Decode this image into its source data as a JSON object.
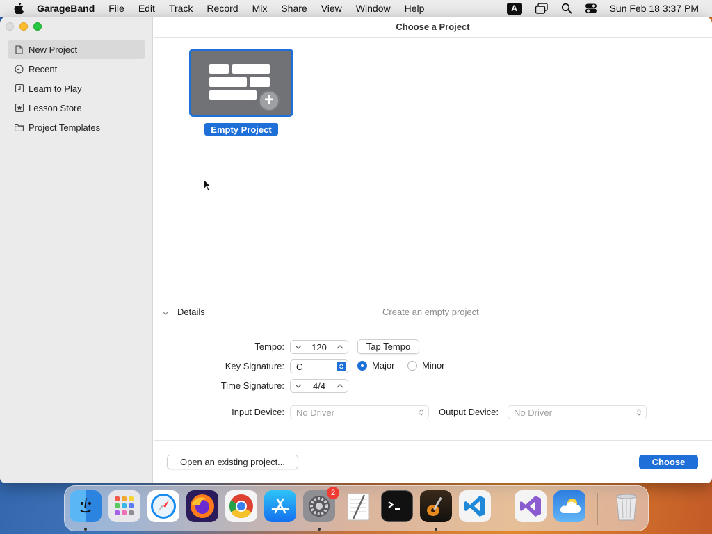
{
  "menubar": {
    "app_name": "GarageBand",
    "menus": [
      "File",
      "Edit",
      "Track",
      "Record",
      "Mix",
      "Share",
      "View",
      "Window",
      "Help"
    ],
    "input_source": "A",
    "clock": "Sun Feb 18  3:37 PM"
  },
  "window": {
    "title": "Choose a Project"
  },
  "sidebar": {
    "items": [
      {
        "label": "New Project",
        "icon": "document-icon",
        "selected": true
      },
      {
        "label": "Recent",
        "icon": "clock-icon",
        "selected": false
      },
      {
        "label": "Learn to Play",
        "icon": "music-note-icon",
        "selected": false
      },
      {
        "label": "Lesson Store",
        "icon": "star-icon",
        "selected": false
      },
      {
        "label": "Project Templates",
        "icon": "folder-icon",
        "selected": false
      }
    ]
  },
  "template": {
    "label": "Empty Project"
  },
  "details": {
    "title": "Details",
    "description": "Create an empty project",
    "tempo_label": "Tempo:",
    "tempo_value": "120",
    "tap_tempo": "Tap Tempo",
    "key_label": "Key Signature:",
    "key_value": "C",
    "major_label": "Major",
    "minor_label": "Minor",
    "mode_selected": "Major",
    "time_label": "Time Signature:",
    "time_value": "4/4",
    "input_label": "Input Device:",
    "input_value": "No Driver",
    "output_label": "Output Device:",
    "output_value": "No Driver"
  },
  "footer": {
    "open_existing": "Open an existing project...",
    "choose": "Choose"
  },
  "dock": {
    "apps": [
      "Finder",
      "Launchpad",
      "Safari",
      "Firefox",
      "Chrome",
      "App Store",
      "System Settings",
      "TextEdit",
      "Terminal",
      "GarageBand",
      "VS Code",
      "Visual Studio",
      "Weather",
      "Trash"
    ],
    "settings_badge": "2"
  },
  "colors": {
    "accent": "#1f6fd8",
    "sidebar_bg": "#ebebeb",
    "selected_row": "#d9d9d9"
  }
}
